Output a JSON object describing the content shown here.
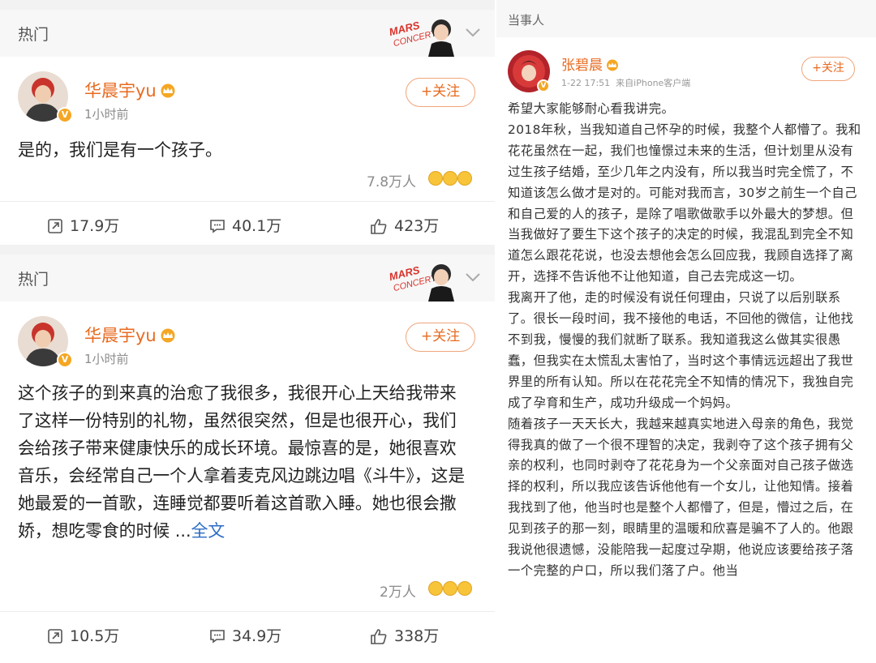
{
  "left_posts": [
    {
      "header": {
        "section": "热门"
      },
      "user": {
        "name": "华晨宇yu",
        "time": "1小时前"
      },
      "follow_label": "+关注",
      "content": "是的，我们是有一个孩子。",
      "likes_count": "7.8万人",
      "actions": {
        "repost": "17.9万",
        "comment": "40.1万",
        "like": "423万"
      }
    },
    {
      "header": {
        "section": "热门"
      },
      "user": {
        "name": "华晨宇yu",
        "time": "1小时前"
      },
      "follow_label": "+关注",
      "content": "这个孩子的到来真的治愈了我很多，我很开心上天给我带来了这样一份特别的礼物，虽然很突然，但是也很开心，我们会给孩子带来健康快乐的成长环境。最惊喜的是，她很喜欢音乐，会经常自己一个人拿着麦克风边跳边唱《斗牛》，这是她最爱的一首歌，连睡觉都要听着这首歌入睡。她也很会撒娇，想吃零食的时候 ...",
      "more_link": "全文",
      "likes_count": "2万人",
      "actions": {
        "repost": "10.5万",
        "comment": "34.9万",
        "like": "338万"
      }
    }
  ],
  "right_post": {
    "label": "当事人",
    "user": {
      "name": "张碧晨",
      "time": "1-22 17:51",
      "source": "来自iPhone客户端"
    },
    "follow_label": "+关注",
    "paragraphs": [
      "希望大家能够耐心看我讲完。",
      "2018年秋，当我知道自己怀孕的时候，我整个人都懵了。我和花花虽然在一起，我们也憧憬过未来的生活，但计划里从没有过生孩子结婚，至少几年之内没有，所以我当时完全慌了，不知道该怎么做才是对的。可能对我而言，30岁之前生一个自己和自己爱的人的孩子，是除了唱歌做歌手以外最大的梦想。但当我做好了要生下这个孩子的决定的时候，我混乱到完全不知道怎么跟花花说，也没去想他会怎么回应我，我顾自选择了离开，选择不告诉他不让他知道，自己去完成这一切。",
      "我离开了他，走的时候没有说任何理由，只说了以后别联系了。很长一段时间，我不接他的电话，不回他的微信，让他找不到我，慢慢的我们就断了联系。我知道我这么做其实很愚蠢，但我实在太慌乱太害怕了，当时这个事情远远超出了我世界里的所有认知。所以在花花完全不知情的情况下，我独自完成了孕育和生产，成功升级成一个妈妈。",
      "随着孩子一天天长大，我越来越真实地进入母亲的角色，我觉得我真的做了一个很不理智的决定，我剥夺了这个孩子拥有父亲的权利，也同时剥夺了花花身为一个父亲面对自己孩子做选择的权利，所以我应该告诉他他有一个女儿，让他知情。接着我找到了他，他当时也是整个人都懵了，但是，懵过之后，在见到孩子的那一刻，眼睛里的温暖和欣喜是骗不了人的。他跟我说他很遗憾，没能陪我一起度过孕期，他说应该要给孩子落一个完整的户口，所以我们落了户。他当"
    ]
  }
}
